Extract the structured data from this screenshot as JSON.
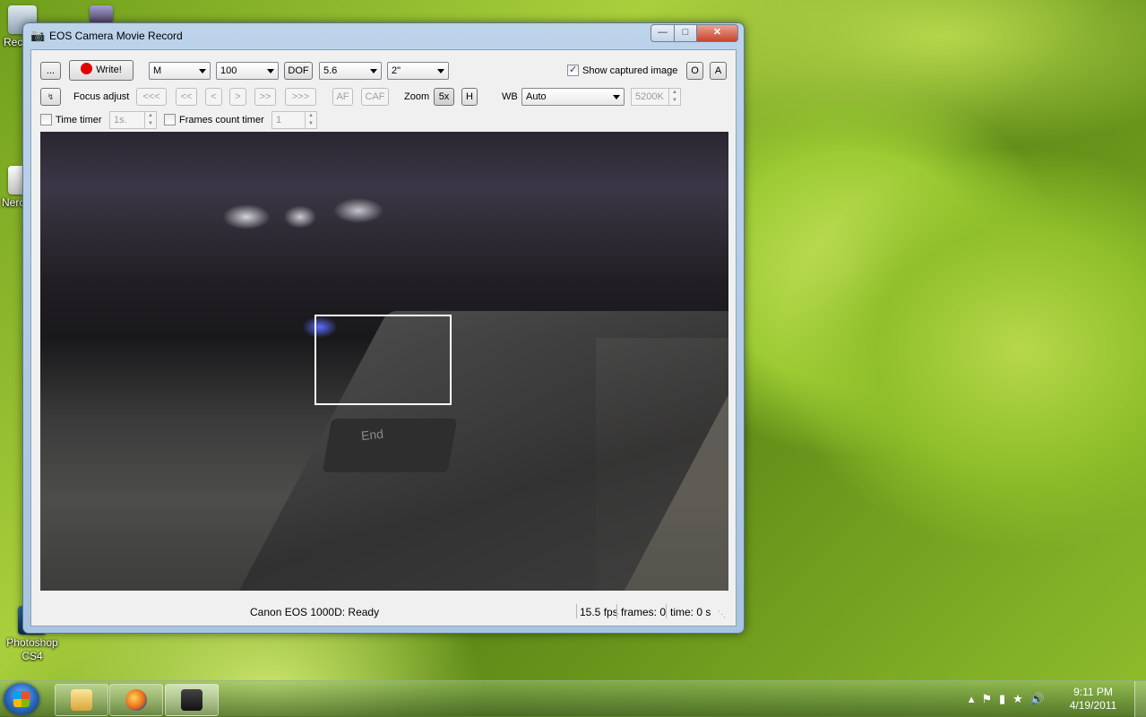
{
  "desktop": {
    "icons": [
      {
        "label": "Rec"
      },
      {
        "label": "Nerc"
      },
      {
        "label": "Photoshop CS4"
      }
    ]
  },
  "window": {
    "title": "EOS Camera Movie Record",
    "controls": {
      "minimize": "—",
      "maximize": "□",
      "close": "✕"
    }
  },
  "toolbar": {
    "more_button": "...",
    "write_button": "Write!",
    "mode_select": "M",
    "iso_select": "100",
    "dof_button": "DOF",
    "aperture_select": "5.6",
    "shutter_select": "2\"",
    "show_captured_label": "Show captured image",
    "show_captured_checked": true,
    "o_button": "O",
    "a_button": "A"
  },
  "focus_row": {
    "focus_label": "Focus adjust",
    "buttons": [
      "<<<",
      "<<",
      "<",
      ">",
      ">>",
      ">>>"
    ],
    "af_button": "AF",
    "caf_button": "CAF",
    "zoom_label": "Zoom",
    "zoom_5x": "5x",
    "zoom_h": "H",
    "wb_label": "WB",
    "wb_select": "Auto",
    "kelvin_value": "5200K"
  },
  "timer_row": {
    "time_timer_label": "Time timer",
    "time_timer_value": "1s.",
    "frames_timer_label": "Frames count timer",
    "frames_timer_value": "1"
  },
  "liveview": {
    "key_text": "End"
  },
  "status": {
    "camera": "Canon EOS 1000D: Ready",
    "fps": "15.5 fps",
    "frames": "frames: 0",
    "time": "time: 0 s"
  },
  "taskbar": {
    "clock_time": "9:11 PM",
    "clock_date": "4/19/2011"
  }
}
